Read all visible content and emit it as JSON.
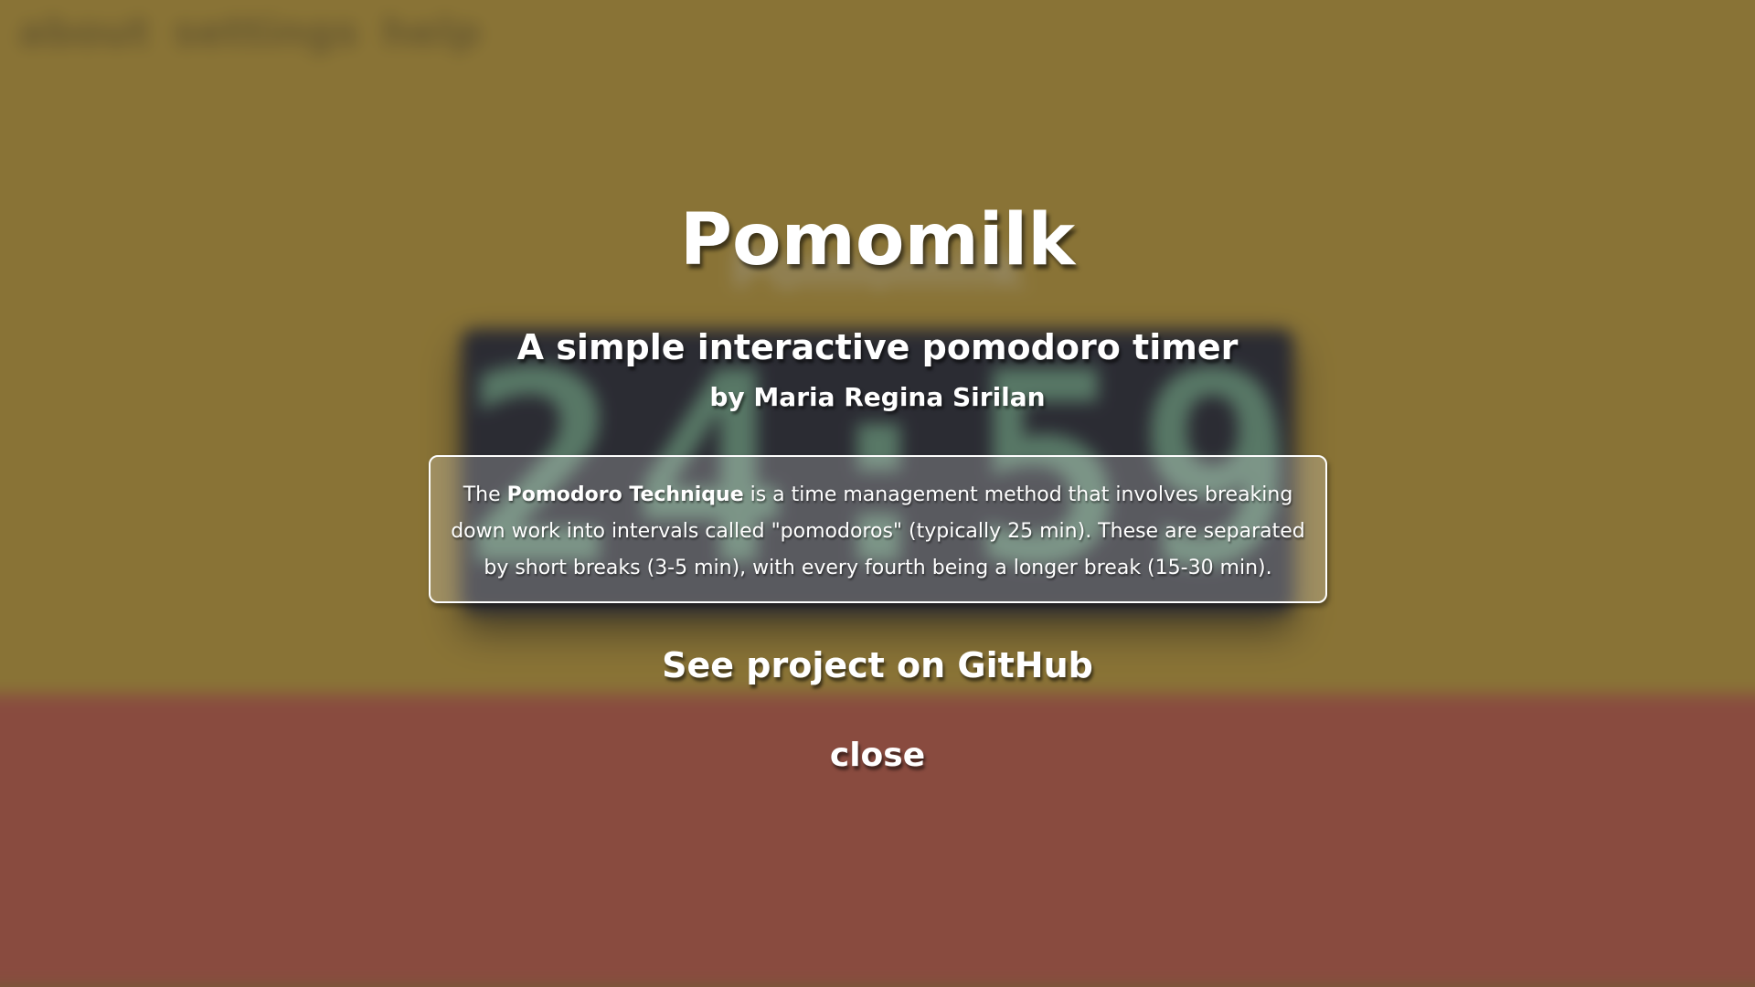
{
  "background": {
    "nav_items": [
      "about",
      "settings",
      "help"
    ],
    "app_title": "Pomomilk",
    "timer_display": "24:59",
    "colors": {
      "work_panel": "#c9a132",
      "break_panel": "#c95843",
      "timer_panel": "#1e1f2d",
      "timer_digits": "#6fa989"
    }
  },
  "modal": {
    "title": "Pomomilk",
    "subtitle": "A simple interactive pomodoro timer",
    "author": "by Maria Regina Sirilan",
    "info": {
      "prefix": "The ",
      "highlight": "Pomodoro Technique",
      "body": " is a time management method that involves breaking down work into intervals called \"pomodoros\" (typically 25 min). These are separated by short breaks (3-5 min), with every fourth being a longer break (15-30 min)."
    },
    "github_link": "See project on GitHub",
    "close_label": "close"
  }
}
